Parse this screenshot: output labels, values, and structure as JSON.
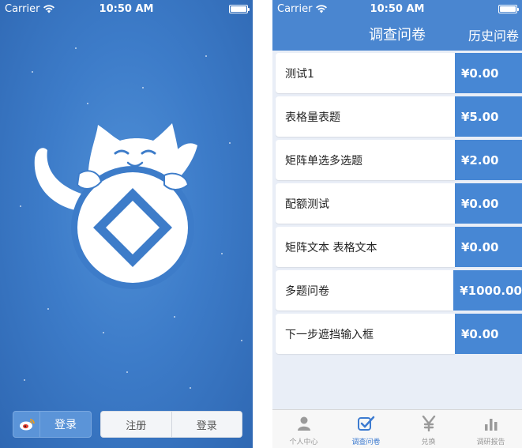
{
  "status_bar": {
    "carrier": "Carrier",
    "time": "10:50 AM"
  },
  "left_screen": {
    "icons": {
      "wifi": "wifi-icon",
      "battery": "battery-icon",
      "mascot": "cat-mascot-icon",
      "weibo": "weibo-icon"
    },
    "weibo_login_label": "登录",
    "register_label": "注册",
    "login_label": "登录"
  },
  "right_screen": {
    "nav": {
      "title": "调查问卷",
      "right_label": "历史问卷"
    },
    "surveys": [
      {
        "title": "测试1",
        "price": "¥0.00"
      },
      {
        "title": "表格量表题",
        "price": "¥5.00"
      },
      {
        "title": "矩阵单选多选题",
        "price": "¥2.00"
      },
      {
        "title": "配额测试",
        "price": "¥0.00"
      },
      {
        "title": "矩阵文本 表格文本",
        "price": "¥0.00"
      },
      {
        "title": "多题问卷",
        "price": "¥1000.00"
      },
      {
        "title": "下一步遮挡输入框",
        "price": "¥0.00"
      }
    ],
    "tabs": [
      {
        "label": "个人中心",
        "icon": "person-icon",
        "active": false
      },
      {
        "label": "调查问卷",
        "icon": "checkbox-icon",
        "active": true
      },
      {
        "label": "兑换",
        "icon": "yen-icon",
        "active": false
      },
      {
        "label": "调研报告",
        "icon": "bar-chart-icon",
        "active": false
      }
    ]
  },
  "colors": {
    "brand_blue": "#4a86d0",
    "price_blue": "#4787d4",
    "active_tab": "#3d7bd0"
  }
}
